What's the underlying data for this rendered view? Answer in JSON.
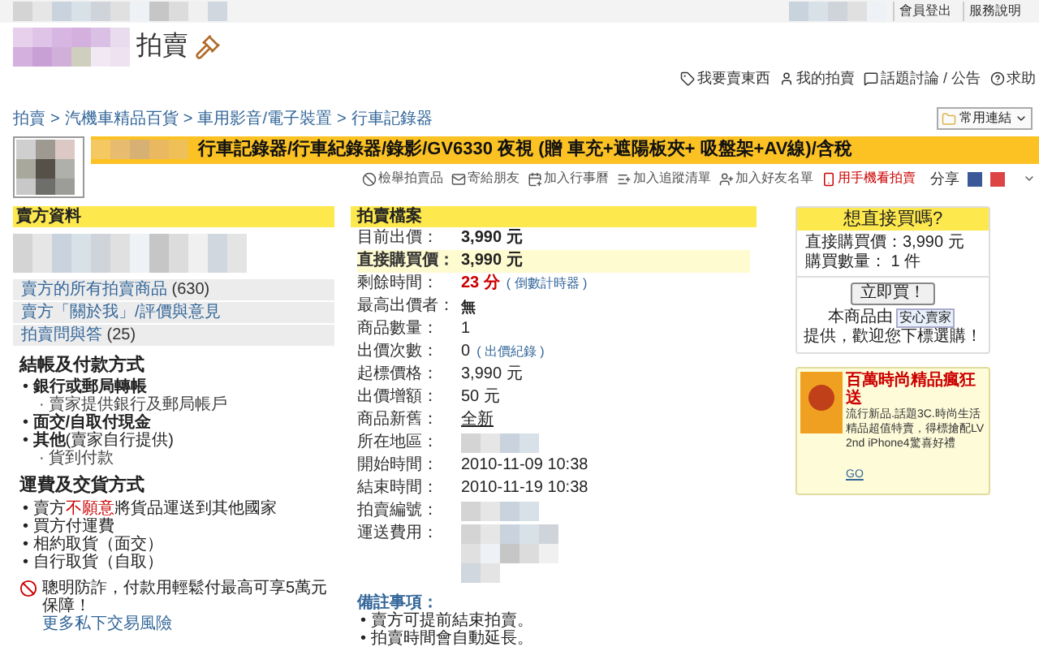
{
  "top_bar": {
    "links": [
      "會員登出",
      "服務說明"
    ]
  },
  "header": {
    "title": "拍賣"
  },
  "nav_links": [
    {
      "label": "我要賣東西",
      "kind": "sell"
    },
    {
      "label": "我的拍賣",
      "kind": "user"
    },
    {
      "label": "話題討論 / 公告",
      "kind": "chat"
    },
    {
      "label": "求助",
      "kind": "help"
    }
  ],
  "breadcrumb": {
    "items": [
      "拍賣",
      "汽機車精品百貨",
      "車用影音/電子裝置",
      "行車記錄器"
    ],
    "separator": ">"
  },
  "quick_links": {
    "label": "常用連結"
  },
  "item_title": "行車記錄器/行車紀錄器/錄影/GV6330 夜視 (贈 車充+遮陽板夾+ 吸盤架+AV線)/含稅",
  "actions": [
    {
      "label": "檢舉拍賣品",
      "kind": "report"
    },
    {
      "label": "寄給朋友",
      "kind": "mail"
    },
    {
      "label": "加入行事曆",
      "kind": "calendar"
    },
    {
      "label": "加入追蹤清單",
      "kind": "track"
    },
    {
      "label": "加入好友名單",
      "kind": "friend"
    },
    {
      "label": "用手機看拍賣",
      "kind": "mobile"
    }
  ],
  "share": {
    "label": "分享"
  },
  "seller": {
    "heading": "賣方資料",
    "links": [
      {
        "label": "賣方的所有拍賣商品",
        "count": "(630)"
      },
      {
        "label": "賣方「關於我」/評價與意見"
      },
      {
        "label": "拍賣問與答",
        "count": "(25)"
      }
    ],
    "bullet": "•",
    "sub_bullet": "·",
    "payment": {
      "heading": "結帳及付款方式",
      "items": [
        {
          "text": "**銀行或郵局轉帳**",
          "children": [
            "賣家提供銀行及郵局帳戶"
          ]
        },
        {
          "text": "**面交/自取付現金**"
        },
        {
          "text": "**其他**(賣家自行提供)",
          "children": [
            "貨到付款"
          ]
        }
      ]
    },
    "shipping": {
      "heading": "運費及交貨方式",
      "items": [
        [
          {
            "text": "賣方",
            "emphasis": false
          },
          {
            "text": "不願意",
            "emphasis": true
          },
          {
            "text": "將貨品運送到其他國家",
            "emphasis": false
          }
        ],
        [
          {
            "text": "買方付運費",
            "emphasis": false
          }
        ],
        [
          {
            "text": "相約取貨（面交）",
            "emphasis": false
          }
        ],
        [
          {
            "text": "自行取貨（自取）",
            "emphasis": false
          }
        ]
      ]
    },
    "warning": {
      "text": "聰明防詐，付款用輕鬆付最高可享5萬元保障！",
      "link": "更多私下交易風險"
    }
  },
  "auction": {
    "heading": "拍賣檔案",
    "rows": [
      {
        "label": "目前出價：",
        "value": "3,990 元",
        "kind": "bold"
      },
      {
        "label": "直接購買價：",
        "value": "3,990 元",
        "kind": "highlight"
      },
      {
        "label": "剩餘時間：",
        "value": "23 分",
        "note": "( 倒數計時器 )",
        "kind": "countdown"
      },
      {
        "label": "最高出價者：",
        "value": "無",
        "kind": "small"
      },
      {
        "label": "商品數量：",
        "value": "1",
        "kind": "plain"
      },
      {
        "label": "出價次數：",
        "value": "0",
        "note": "( 出價紀錄 )",
        "kind": "plain"
      },
      {
        "label": "起標價格：",
        "value": "3,990 元",
        "kind": "plain"
      },
      {
        "label": "出價增額：",
        "value": "50 元",
        "kind": "plain"
      },
      {
        "label": "商品新舊：",
        "value": "全新",
        "kind": "link"
      },
      {
        "label": "所在地區：",
        "kind": "blurred"
      },
      {
        "label": "開始時間：",
        "value": "2010-11-09 10:38",
        "kind": "plain"
      },
      {
        "label": "結束時間：",
        "value": "2010-11-19 10:38",
        "kind": "plain"
      },
      {
        "label": "拍賣編號：",
        "kind": "blurred"
      },
      {
        "label": "運送費用：",
        "kind": "blurred_block"
      }
    ],
    "notes_heading": "備註事項：",
    "note_bullet": "•",
    "notes": [
      "賣方可提前結束拍賣。",
      "拍賣時間會自動延長。"
    ]
  },
  "buy_box": {
    "heading": "想直接買嗎?",
    "price": "直接購買價：3,990 元",
    "quantity": "購買數量： 1 件",
    "button": "立即買！",
    "text_before": "本商品由",
    "badge": "安心賣家",
    "text_after": "提供，歡迎您下標選購！"
  },
  "promo": {
    "heading": "百萬時尚精品瘋狂送",
    "lines": [
      "流行新品.話題3C.時尚生活",
      "精品超值特賣，得標搶配LV",
      "2nd iPhone4驚喜好禮"
    ],
    "go": "GO"
  }
}
